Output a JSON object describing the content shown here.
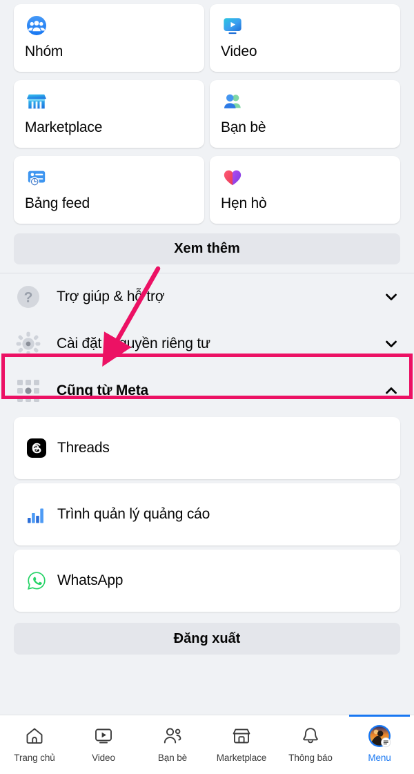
{
  "shortcuts": {
    "tiles": [
      {
        "label": "Nhóm",
        "icon": "groups-icon"
      },
      {
        "label": "Video",
        "icon": "video-icon"
      },
      {
        "label": "Marketplace",
        "icon": "marketplace-icon"
      },
      {
        "label": "Bạn bè",
        "icon": "friends-icon"
      },
      {
        "label": "Bảng feed",
        "icon": "feeds-icon"
      },
      {
        "label": "Hẹn hò",
        "icon": "dating-heart-icon"
      }
    ],
    "see_more_label": "Xem thêm"
  },
  "accordions": [
    {
      "label": "Trợ giúp & hỗ trợ",
      "icon": "help-question-icon",
      "chevron": "chevron-down-icon",
      "expanded": false
    },
    {
      "label": "Cài đặt & quyền riêng tư",
      "icon": "settings-gear-icon",
      "chevron": "chevron-down-icon",
      "expanded": false
    },
    {
      "label": "Cũng từ Meta",
      "icon": "meta-apps-grid-icon",
      "chevron": "chevron-up-icon",
      "expanded": true
    }
  ],
  "meta_apps": [
    {
      "label": "Threads",
      "icon": "threads-icon"
    },
    {
      "label": "Trình quản lý quảng cáo",
      "icon": "ads-manager-icon"
    },
    {
      "label": "WhatsApp",
      "icon": "whatsapp-icon"
    }
  ],
  "logout_label": "Đăng xuất",
  "bottom_nav": [
    {
      "label": "Trang chủ",
      "icon": "home-icon",
      "active": false
    },
    {
      "label": "Video",
      "icon": "video-play-icon",
      "active": false
    },
    {
      "label": "Bạn bè",
      "icon": "friends-outline-icon",
      "active": false
    },
    {
      "label": "Marketplace",
      "icon": "store-icon",
      "active": false
    },
    {
      "label": "Thông báo",
      "icon": "bell-icon",
      "active": false
    },
    {
      "label": "Menu",
      "icon": "avatar-menu-icon",
      "active": true
    }
  ],
  "annotation": {
    "highlight_color": "#ec1164",
    "target_row_label": "Cài đặt & quyền riêng tư"
  },
  "colors": {
    "page_background": "#f0f2f5",
    "card_background": "#ffffff",
    "button_background": "#e4e6eb",
    "primary_text": "#050505",
    "accent_blue": "#1877f2",
    "annotation_pink": "#ec1164"
  }
}
